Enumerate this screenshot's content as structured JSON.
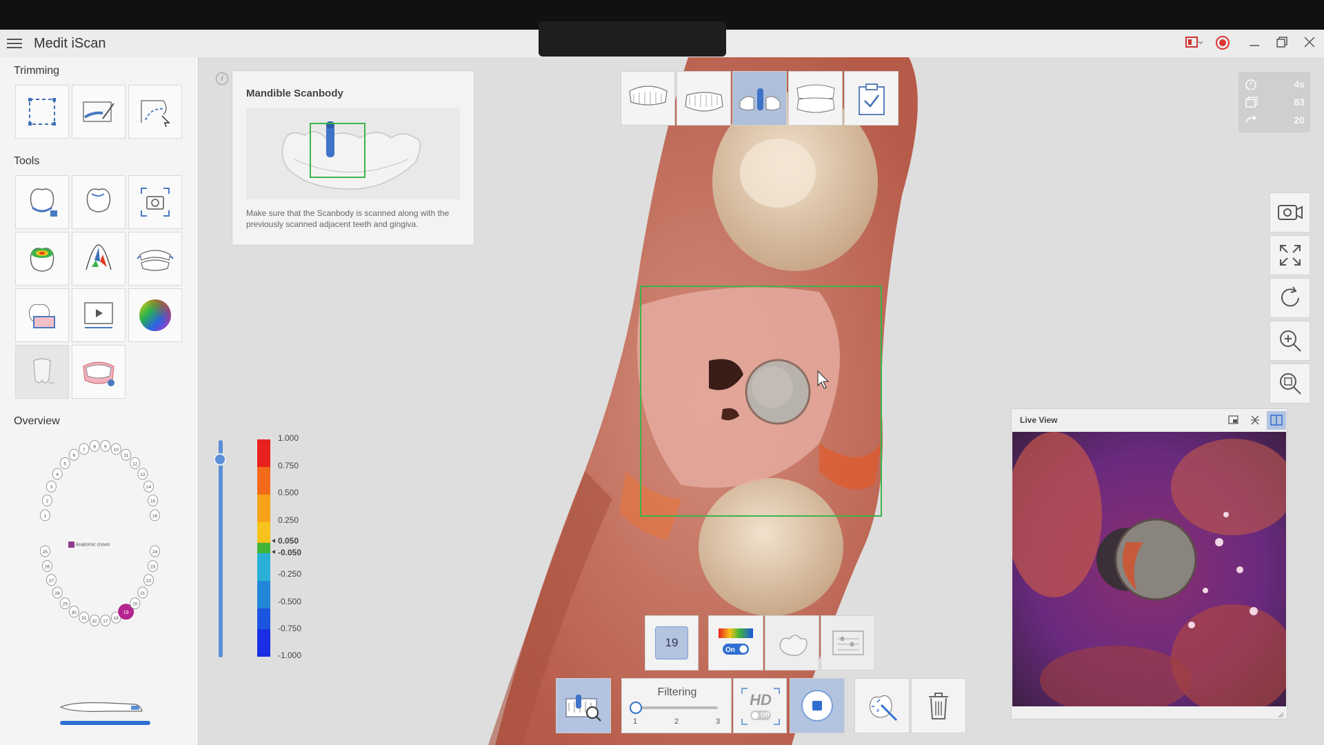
{
  "app": {
    "title": "Medit iScan"
  },
  "sidebar": {
    "trimming_title": "Trimming",
    "tools_title": "Tools",
    "overview_title": "Overview",
    "overview_legend": "Anatomic crown",
    "teeth_upper_left": [
      "8",
      "7",
      "6",
      "5",
      "4",
      "3",
      "2",
      "1"
    ],
    "teeth_upper_right": [
      "9",
      "10",
      "11",
      "12",
      "13",
      "14",
      "15",
      "16"
    ],
    "teeth_lower_left": [
      "32",
      "31",
      "30",
      "29",
      "28",
      "27",
      "26",
      "25"
    ],
    "teeth_lower_right": [
      "17",
      "18",
      "19",
      "20",
      "21",
      "22",
      "23",
      "24"
    ],
    "selected_tooth": "19"
  },
  "guide": {
    "title": "Mandible Scanbody",
    "description": "Make sure that the Scanbody is scanned along with the previously scanned adjacent teeth and gingiva."
  },
  "stats": {
    "time": "4s",
    "shots": "83",
    "rotations": "20"
  },
  "legend": {
    "labels": [
      "1.000",
      "0.750",
      "0.500",
      "0.250",
      "0.050",
      "-0.050",
      "-0.250",
      "-0.500",
      "-0.750",
      "-1.000"
    ],
    "colors": [
      "#e8211c",
      "#f36a1a",
      "#f7a31a",
      "#f6c21b",
      "#41b43a",
      "#2ab0d6",
      "#2287d9",
      "#1d54e0",
      "#1a2ee3"
    ]
  },
  "bottom": {
    "tooth_number": "19",
    "color_toggle": "On",
    "filtering_label": "Filtering",
    "filtering_ticks": [
      "1",
      "2",
      "3"
    ],
    "filtering_value": 1,
    "hd_label": "HD",
    "hd_toggle": "Off"
  },
  "live_view": {
    "title": "Live View"
  },
  "colors": {
    "accent": "#5b8fd6",
    "selection": "#35c13a",
    "overview_dot": "#b5248f"
  }
}
